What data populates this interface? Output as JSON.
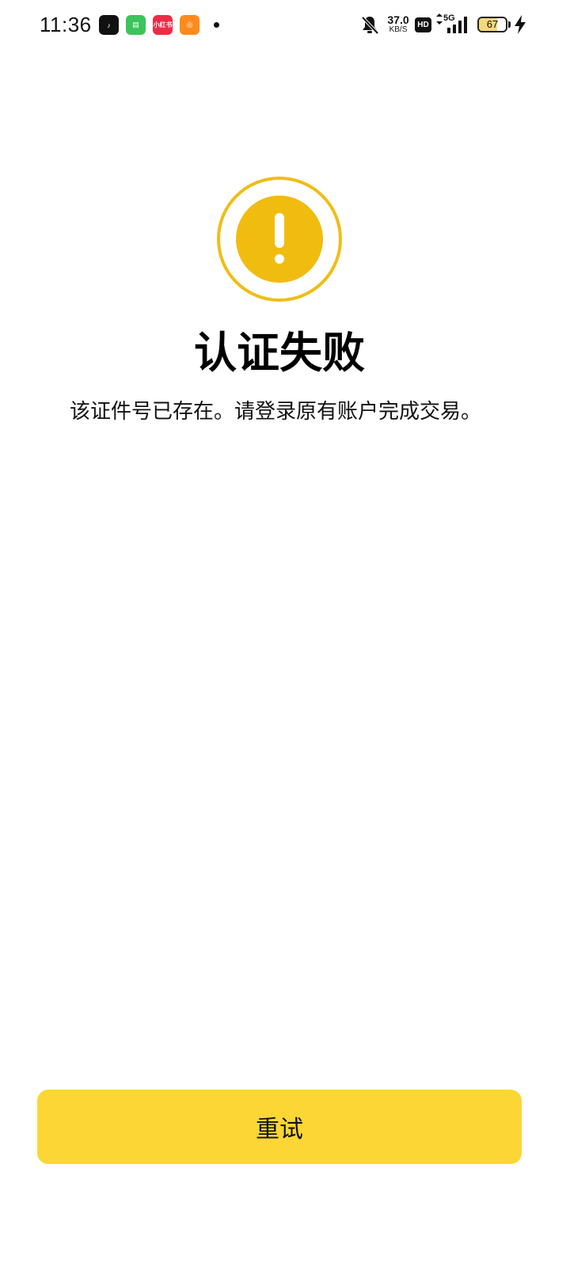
{
  "status_bar": {
    "time": "11:36",
    "app_icons": [
      {
        "name": "tiktok-icon",
        "glyph": "♪"
      },
      {
        "name": "messages-icon",
        "glyph": "▤"
      },
      {
        "name": "xiaohongshu-icon",
        "glyph": "小红书"
      },
      {
        "name": "kuaishou-icon",
        "glyph": "◎"
      }
    ],
    "network_speed": "37.0",
    "network_speed_unit": "KB/S",
    "hd_label": "HD",
    "network_type": "5G",
    "battery_level": "67",
    "battery_fraction": 0.67,
    "icons": [
      "bell-muted-icon",
      "signal-icon",
      "battery-icon",
      "charging-icon"
    ]
  },
  "main": {
    "status_icon": "warning-icon",
    "title": "认证失败",
    "message": "该证件号已存在。请登录原有账户完成交易。",
    "retry_label": "重试"
  },
  "colors": {
    "warning": "#f0bc10",
    "button": "#fcd635",
    "battery": "#f6d77a"
  }
}
